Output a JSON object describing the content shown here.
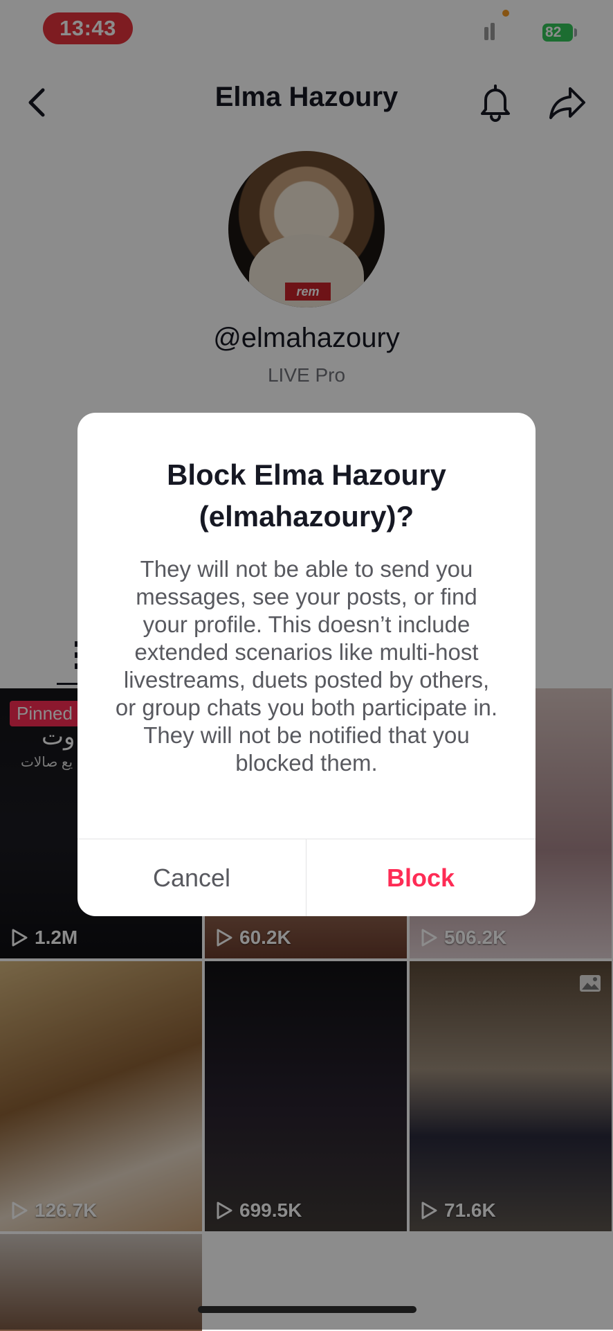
{
  "status_bar": {
    "time": "13:43",
    "battery": "82"
  },
  "header": {
    "title": "Elma Hazoury"
  },
  "profile": {
    "handle": "@elmahazoury",
    "subtitle": "LIVE Pro"
  },
  "grid": {
    "pinned_label": "Pinned",
    "pinned_arabic_line1": "وت",
    "pinned_arabic_line2": "يع صالات",
    "views": [
      "1.2M",
      "60.2K",
      "506.2K",
      "126.7K",
      "699.5K",
      "71.6K"
    ]
  },
  "dialog": {
    "title": "Block Elma Hazoury (elmahazoury)?",
    "body": "They will not be able to send you messages, see your posts, or find your profile. This doesn’t include extended scenarios like multi-host livestreams, duets posted by others, or group chats you both participate in. They will not be notified that you blocked them.",
    "cancel_label": "Cancel",
    "block_label": "Block"
  },
  "colors": {
    "accent": "#fe2c55",
    "status_time_bg": "#e5333d",
    "battery": "#34c759"
  },
  "icons": [
    "back-icon",
    "bell-icon",
    "share-icon",
    "signal-icon",
    "wifi-icon",
    "play-icon",
    "photo-icon"
  ]
}
